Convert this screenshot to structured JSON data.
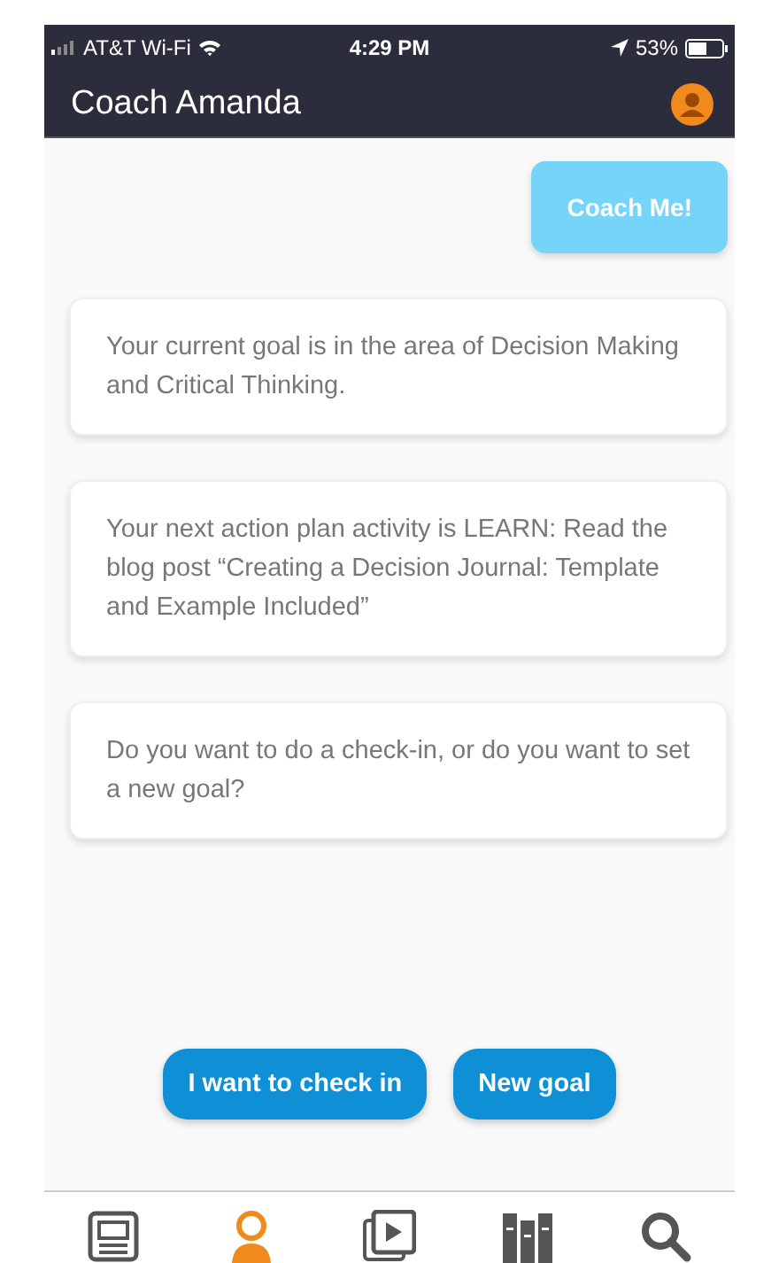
{
  "status_bar": {
    "carrier": "AT&T Wi-Fi",
    "time": "4:29 PM",
    "battery": "53%"
  },
  "header": {
    "title": "Coach Amanda"
  },
  "messages": [
    {
      "kind": "user",
      "text": "Coach Me!"
    },
    {
      "kind": "coach",
      "text": "Your current goal is in the area of Decision Making and Critical Thinking."
    },
    {
      "kind": "coach",
      "text": "Your next action plan activity is LEARN: Read the blog post “Creating a Decision Journal: Template and Example Included”"
    },
    {
      "kind": "coach",
      "text": "Do you want to do a check-in, or do you want to set a new goal?"
    }
  ],
  "quick_replies": [
    "I want to check in",
    "New goal"
  ],
  "tab_bar": [
    {
      "kind": "news",
      "selected": false
    },
    {
      "kind": "coach",
      "selected": true
    },
    {
      "kind": "video",
      "selected": false
    },
    {
      "kind": "library",
      "selected": false
    },
    {
      "kind": "search",
      "selected": false
    }
  ]
}
